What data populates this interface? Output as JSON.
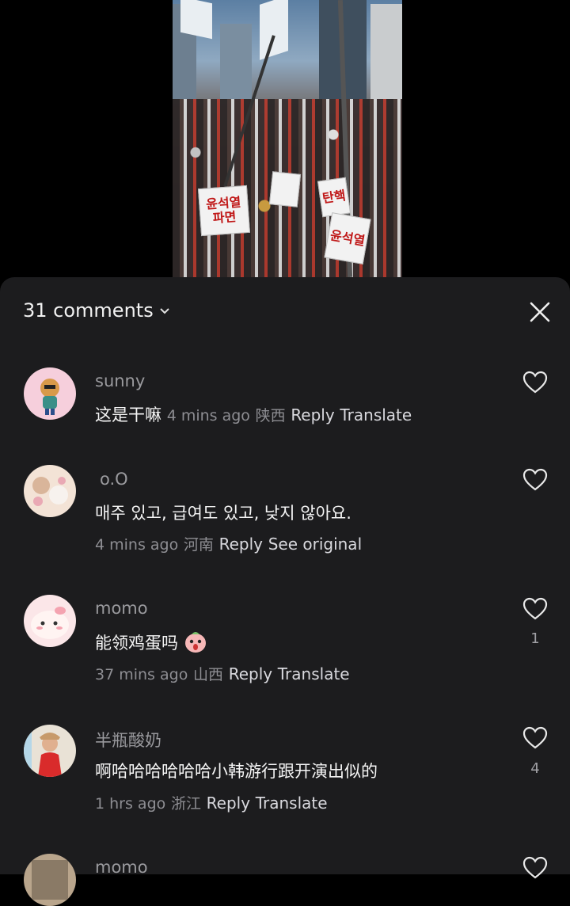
{
  "header": {
    "comment_count_label": "31 comments"
  },
  "comments": [
    {
      "username": "sunny",
      "text": "这是干嘛",
      "time": "4 mins ago",
      "location": "陕西",
      "reply": "Reply",
      "action": "Translate",
      "likes": ""
    },
    {
      "username": "o.O",
      "text": "매주 있고, 급여도 있고, 낮지 않아요.",
      "time": "4 mins ago",
      "location": "河南",
      "reply": "Reply",
      "action": "See original",
      "likes": ""
    },
    {
      "username": "momo",
      "text": "能领鸡蛋吗",
      "time": "37 mins ago",
      "location": "山西",
      "reply": "Reply",
      "action": "Translate",
      "likes": "1"
    },
    {
      "username": "半瓶酸奶",
      "text": "啊哈哈哈哈哈哈小韩游行跟开演出似的",
      "time": "1 hrs ago",
      "location": "浙江",
      "reply": "Reply",
      "action": "Translate",
      "likes": "4"
    },
    {
      "username": "momo"
    }
  ],
  "video": {
    "signs": [
      "윤석열 파면",
      "탄핵",
      "윤석열"
    ]
  },
  "colors": {
    "sheet_bg": "#1c1c1e",
    "meta": "#8e8e93",
    "text": "#f5f5f5"
  }
}
